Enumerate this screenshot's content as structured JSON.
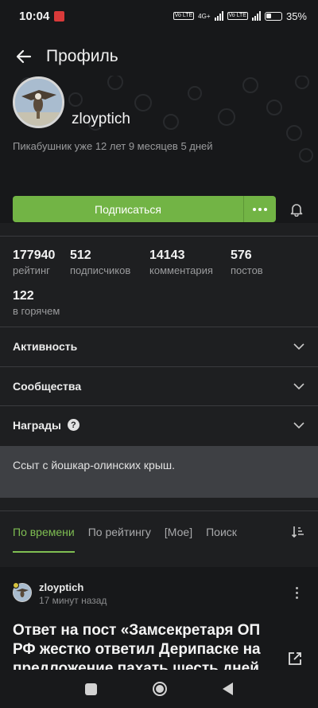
{
  "status_bar": {
    "time": "10:04",
    "network1": "4G+",
    "volte1": "Vo LTE",
    "volte2": "Vo LTE",
    "battery": "35%"
  },
  "topbar": {
    "title": "Профиль"
  },
  "profile": {
    "username": "zloyptich",
    "since": "Пикабушник уже 12 лет 9 месяцев 5 дней",
    "subscribe_label": "Подписаться"
  },
  "stats": [
    {
      "value": "177940",
      "label": "рейтинг"
    },
    {
      "value": "512",
      "label": "подписчиков"
    },
    {
      "value": "14143",
      "label": "комментария"
    },
    {
      "value": "576",
      "label": "постов"
    },
    {
      "value": "122",
      "label": "в горячем"
    }
  ],
  "sections": [
    {
      "label": "Активность"
    },
    {
      "label": "Сообщества"
    },
    {
      "label": "Награды"
    }
  ],
  "bio": "Ссыт с йошкар-олинских крыш.",
  "tabs": [
    {
      "label": "По времени"
    },
    {
      "label": "По рейтингу"
    },
    {
      "label": "[Мое]"
    },
    {
      "label": "Поиск"
    }
  ],
  "post": {
    "author": "zloyptich",
    "time": "17 минут назад",
    "title": "Ответ на пост «Замсекретаря ОП РФ жестко ответил Дерипаске на предложение пахать шесть дней"
  },
  "colors": {
    "accent": "#72b445",
    "background": "#1e1f21",
    "header": "#17181a"
  }
}
